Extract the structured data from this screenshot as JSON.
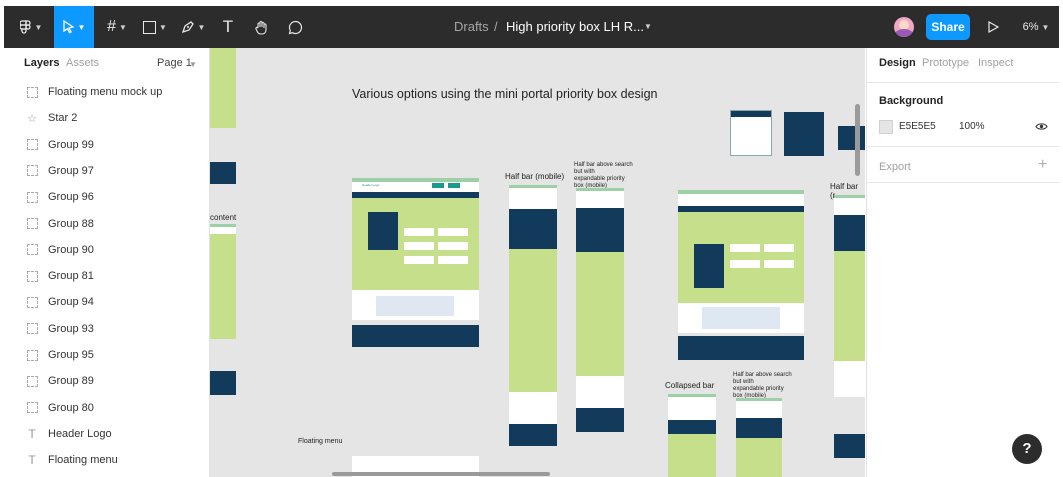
{
  "toolbar": {
    "tools": [
      "main-menu",
      "move",
      "frame",
      "shape",
      "pen",
      "text",
      "hand",
      "comment"
    ],
    "breadcrumb_folder": "Drafts",
    "breadcrumb_separator": "/",
    "file_name": "High priority box LH R...",
    "share_label": "Share",
    "zoom": "6%"
  },
  "left_panel": {
    "tab_layers": "Layers",
    "tab_assets": "Assets",
    "page_label": "Page 1",
    "layers": [
      {
        "label": "Floating menu mock up",
        "icon": "frame"
      },
      {
        "label": "Star 2",
        "icon": "star"
      },
      {
        "label": "Group 99",
        "icon": "group"
      },
      {
        "label": "Group 97",
        "icon": "group"
      },
      {
        "label": "Group 96",
        "icon": "group"
      },
      {
        "label": "Group 88",
        "icon": "group"
      },
      {
        "label": "Group 90",
        "icon": "group"
      },
      {
        "label": "Group 81",
        "icon": "group"
      },
      {
        "label": "Group 94",
        "icon": "group"
      },
      {
        "label": "Group 93",
        "icon": "group"
      },
      {
        "label": "Group 95",
        "icon": "group"
      },
      {
        "label": "Group 89",
        "icon": "group"
      },
      {
        "label": "Group 80",
        "icon": "group"
      },
      {
        "label": "Header Logo",
        "icon": "text"
      },
      {
        "label": "Floating menu",
        "icon": "text"
      }
    ]
  },
  "canvas": {
    "heading": "Various options using the mini portal priority box design",
    "label_content": "content",
    "label_half_bar_mobile": "Half bar (mobile)",
    "label_half_bar_above_1": "Half bar above search",
    "label_half_bar_above_2": "but with",
    "label_half_bar_above_3": "expandable priority",
    "label_half_bar_above_4": "box (mobile)",
    "label_half_bar_right": "Half bar (r",
    "label_collapsed_bar": "Collapsed bar",
    "label_half_bar_above_b1": "Half bar above search",
    "label_half_bar_above_b2": "but with",
    "label_half_bar_above_b3": "expandable priority",
    "label_half_bar_above_b4": "box (mobile)",
    "label_floating_menu": "Floating menu",
    "label_header_logo": "Header Logo",
    "background_color": "#e5e5e5"
  },
  "right_panel": {
    "tab_design": "Design",
    "tab_prototype": "Prototype",
    "tab_inspect": "Inspect",
    "background_title": "Background",
    "bg_hex": "E5E5E5",
    "bg_opacity": "100%",
    "export_label": "Export"
  },
  "help_label": "?"
}
